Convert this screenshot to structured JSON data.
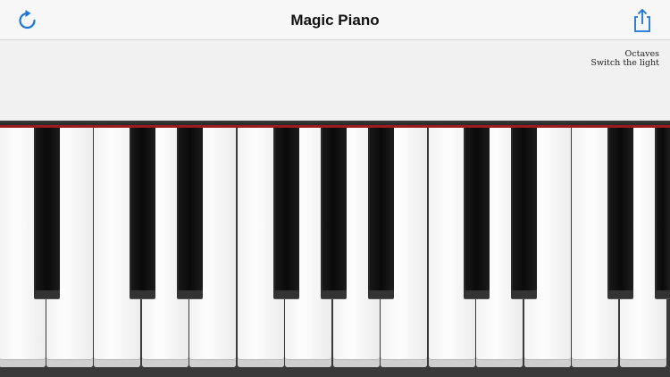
{
  "navbar": {
    "title": "Magic Piano",
    "refresh_icon": "refresh-icon",
    "share_icon": "share-icon",
    "accent_color": "#1a73d9"
  },
  "panel": {
    "octaves_label": "Octaves",
    "switch_light_label": "Switch the light"
  },
  "keyboard": {
    "white_key_count": 15,
    "black_key_count": 11,
    "felt_color": "#9b1c1c"
  }
}
